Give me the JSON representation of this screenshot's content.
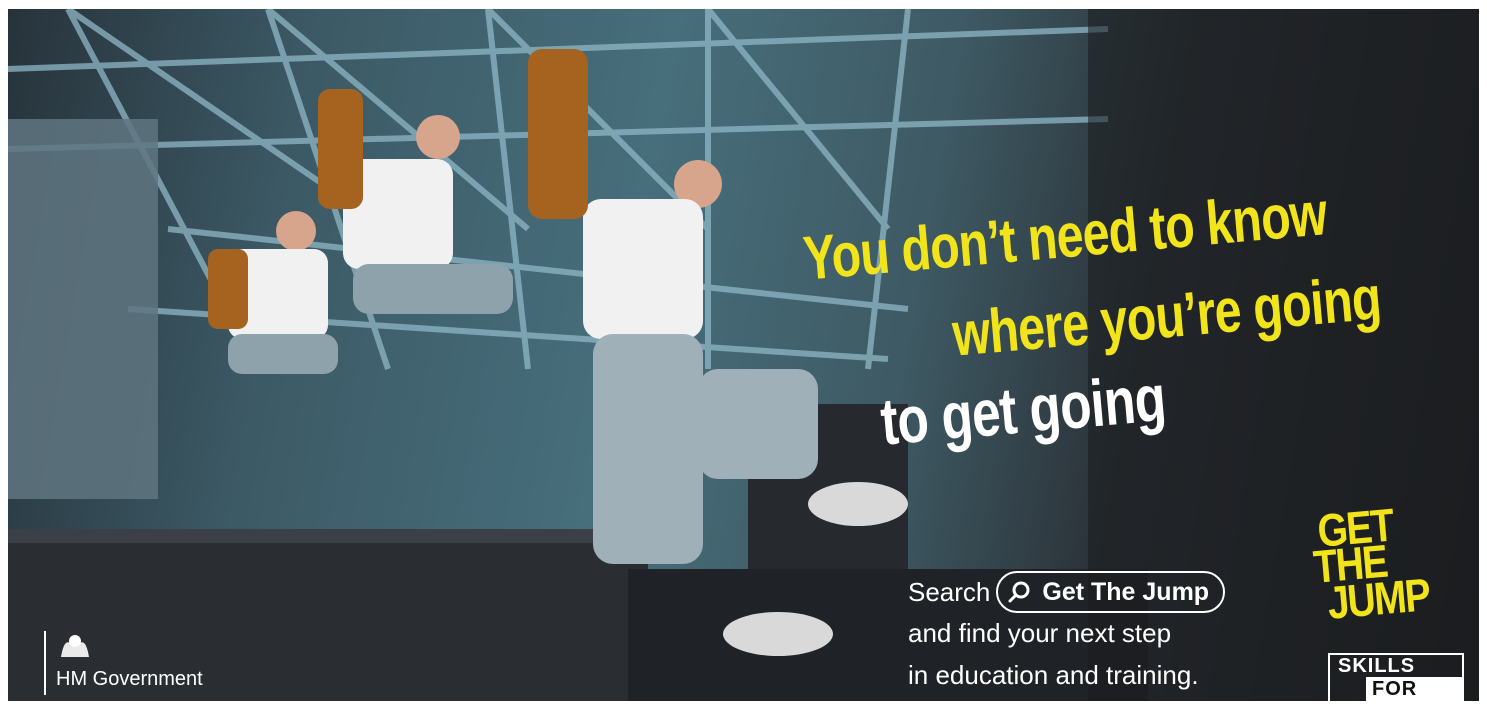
{
  "headline": {
    "line1": "You don’t need to know",
    "line2": "where you’re going",
    "line3": "to get going"
  },
  "cta": {
    "search_word": "Search",
    "search_term": "Get The Jump",
    "line2": "and find your next step",
    "line3": "in education and training."
  },
  "government": {
    "label": "HM Government"
  },
  "logo": {
    "word1": "GET",
    "word2": "THE",
    "word3": "JUMP",
    "skills": "SKILLS",
    "for_life": "FOR LIFE"
  },
  "colors": {
    "accent_yellow": "#f2e41a",
    "text_white": "#ffffff"
  }
}
